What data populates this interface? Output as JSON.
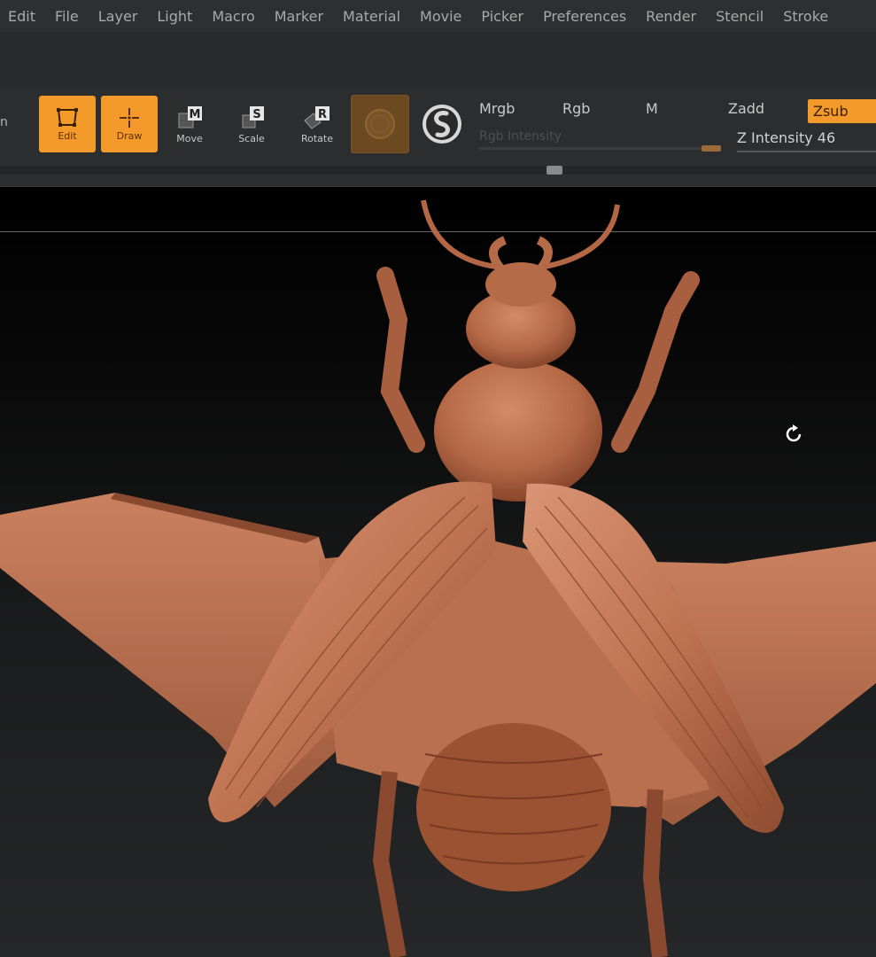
{
  "menu": {
    "items": [
      "Edit",
      "File",
      "Layer",
      "Light",
      "Macro",
      "Marker",
      "Material",
      "Movie",
      "Picker",
      "Preferences",
      "Render",
      "Stencil",
      "Stroke"
    ]
  },
  "toolbar": {
    "partial_left_label": "n",
    "tools": [
      {
        "label": "Edit",
        "icon": "edit-frame-icon",
        "active": true
      },
      {
        "label": "Draw",
        "icon": "draw-crosshair-icon",
        "active": true
      },
      {
        "label": "Move",
        "icon": "move-m-icon",
        "active": false
      },
      {
        "label": "Scale",
        "icon": "scale-s-icon",
        "active": false
      },
      {
        "label": "Rotate",
        "icon": "rotate-r-icon",
        "active": false
      }
    ],
    "material_swatch_icon": "material-sphere-icon",
    "texture_icon": "s-sphere-icon",
    "modes": {
      "mrgb": "Mrgb",
      "rgb": "Rgb",
      "m": "M",
      "zadd": "Zadd",
      "zsub": "Zsub"
    },
    "rgb_intensity": {
      "label": "Rgb Intensity",
      "value_fraction": 0.92
    },
    "z_intensity": {
      "label": "Z Intensity",
      "value": "46"
    },
    "scroll_fraction": 0.63
  },
  "colors": {
    "accent": "#f39a2a",
    "menu_bg": "#2e2f30",
    "toolbar_bg": "#2c2d2e",
    "model": "#b46a4a"
  },
  "viewport": {
    "model": "beetle-sculpt-model",
    "cursor_icon": "rotate-cursor-icon"
  }
}
